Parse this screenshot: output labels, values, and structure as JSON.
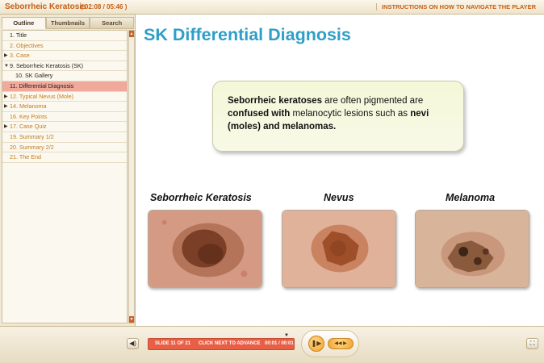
{
  "header": {
    "course_title": "Seborrheic Keratosis",
    "time": "( 02:08 / 05:46 )",
    "instructions": "INSTRUCTIONS ON HOW TO NAVIGATE THE PLAYER"
  },
  "sidebar": {
    "tabs": [
      "Outline",
      "Thumbnails",
      "Search"
    ],
    "items": [
      {
        "label": "1. Title",
        "indent": 0,
        "style": "dark",
        "arrow": ""
      },
      {
        "label": "2. Objectives",
        "indent": 0,
        "style": "link",
        "arrow": ""
      },
      {
        "label": "3. Case",
        "indent": 0,
        "style": "link",
        "arrow": "▶"
      },
      {
        "label": "9. Seborrheic Keratosis (SK)",
        "indent": 0,
        "style": "dark",
        "arrow": "▼"
      },
      {
        "label": "10. SK Gallery",
        "indent": 1,
        "style": "dark",
        "arrow": ""
      },
      {
        "label": "11. Differential Diagnosis",
        "indent": 0,
        "style": "selected",
        "arrow": ""
      },
      {
        "label": "12. Typical Nevus (Mole)",
        "indent": 0,
        "style": "link",
        "arrow": "▶"
      },
      {
        "label": "14. Melanoma",
        "indent": 0,
        "style": "link",
        "arrow": "▶"
      },
      {
        "label": "16. Key Points",
        "indent": 0,
        "style": "link",
        "arrow": ""
      },
      {
        "label": "17. Case Quiz",
        "indent": 0,
        "style": "link",
        "arrow": "▶"
      },
      {
        "label": "19. Summary 1/2",
        "indent": 0,
        "style": "link",
        "arrow": ""
      },
      {
        "label": "20. Summary 2/2",
        "indent": 0,
        "style": "link",
        "arrow": ""
      },
      {
        "label": "21. The End",
        "indent": 0,
        "style": "link",
        "arrow": ""
      }
    ]
  },
  "slide": {
    "title": "SK Differential Diagnosis",
    "callout": {
      "bold1": "Seborrheic keratoses",
      "text1": " are often pigmented are ",
      "bold2": "confused with",
      "text2": " melanocytic lesions such as ",
      "bold3": "nevi (moles) and melanomas."
    },
    "images": [
      {
        "caption": "Seborrheic Keratosis"
      },
      {
        "caption": "Nevus"
      },
      {
        "caption": "Melanoma"
      }
    ]
  },
  "player": {
    "slide_label": "SLIDE 11 OF 21",
    "hint": "CLICK NEXT TO ADVANCE",
    "slide_time": "00:01 / 00:01",
    "volume_icon": "◀)",
    "play_icon": "❚▶",
    "seek_icon": "◀◀ ▶",
    "fullscreen_icon": "⛶"
  },
  "colors": {
    "accent": "#c65e16",
    "title": "#2f9ec8",
    "selected": "#f0a99a",
    "progress": "#e85f46"
  }
}
